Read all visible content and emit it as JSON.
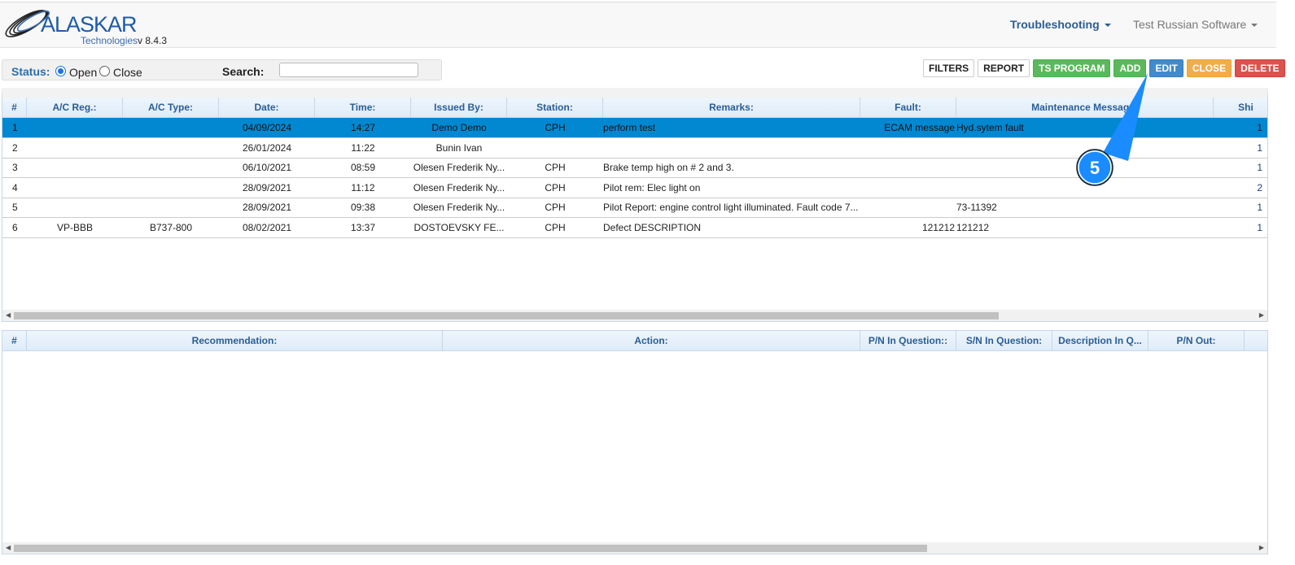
{
  "header": {
    "brand": "ALASKAR",
    "sub": "Technologies",
    "version": "v 8.4.3",
    "nav": [
      "Troubleshooting",
      "Test Russian Software"
    ]
  },
  "filter": {
    "status_label": "Status:",
    "open": "Open",
    "close": "Close",
    "search_label": "Search:",
    "search_value": ""
  },
  "toolbar": {
    "filters": "FILTERS",
    "report": "REPORT",
    "ts_program": "TS PROGRAM",
    "add": "ADD",
    "edit": "EDIT",
    "close": "CLOSE",
    "delete": "DELETE"
  },
  "table1": {
    "headers": [
      "#",
      "A/C Reg.:",
      "A/C Type:",
      "Date:",
      "Time:",
      "Issued By:",
      "Station:",
      "Remarks:",
      "Fault:",
      "Maintenance Message:",
      "Shi"
    ],
    "rows": [
      [
        "1",
        "",
        "",
        "04/09/2024",
        "14:27",
        "Demo Demo",
        "CPH",
        "perform test",
        "ECAM message",
        "Hyd.sytem fault",
        "1"
      ],
      [
        "2",
        "",
        "",
        "26/01/2024",
        "11:22",
        "Bunin Ivan",
        "",
        "",
        "",
        "",
        "1"
      ],
      [
        "3",
        "",
        "",
        "06/10/2021",
        "08:59",
        "Olesen Frederik Ny...",
        "CPH",
        "Brake temp high on # 2 and 3.",
        "",
        "",
        "1"
      ],
      [
        "4",
        "",
        "",
        "28/09/2021",
        "11:12",
        "Olesen Frederik Ny...",
        "CPH",
        "Pilot rem: Elec light on",
        "",
        "",
        "2"
      ],
      [
        "5",
        "",
        "",
        "28/09/2021",
        "09:38",
        "Olesen Frederik Ny...",
        "CPH",
        "Pilot Report: engine control light illuminated. Fault code 7...",
        "",
        "73-11392",
        "1"
      ],
      [
        "6",
        "VP-BBB",
        "B737-800",
        "08/02/2021",
        "13:37",
        "DOSTOEVSKY FE...",
        "CPH",
        "Defect DESCRIPTION",
        "121212",
        "121212",
        "1"
      ]
    ]
  },
  "table2": {
    "headers": [
      "#",
      "Recommendation:",
      "Action:",
      "P/N In Question::",
      "S/N In Question:",
      "Description In Q...",
      "P/N Out:"
    ]
  },
  "callout": {
    "number": "5",
    "color": "#1a8cff"
  }
}
